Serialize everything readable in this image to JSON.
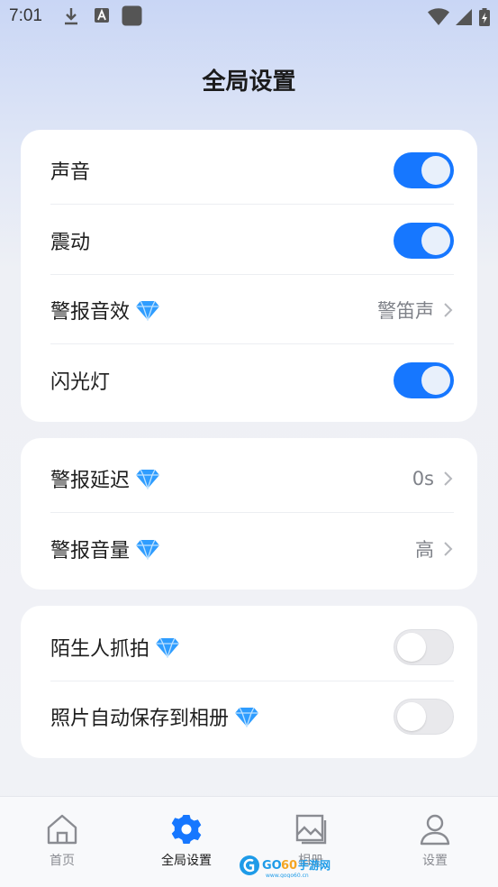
{
  "status_bar": {
    "time": "7:01"
  },
  "title": "全局设置",
  "colors": {
    "accent": "#1677ff",
    "gem": "#2f9dff"
  },
  "groups": [
    {
      "rows": [
        {
          "label": "声音",
          "premium": false,
          "control": "toggle",
          "on": true
        },
        {
          "label": "震动",
          "premium": false,
          "control": "toggle",
          "on": true
        },
        {
          "label": "警报音效",
          "premium": true,
          "control": "value",
          "value": "警笛声"
        },
        {
          "label": "闪光灯",
          "premium": false,
          "control": "toggle",
          "on": true
        }
      ]
    },
    {
      "rows": [
        {
          "label": "警报延迟",
          "premium": true,
          "control": "value",
          "value": "0s"
        },
        {
          "label": "警报音量",
          "premium": true,
          "control": "value",
          "value": "高"
        }
      ]
    },
    {
      "rows": [
        {
          "label": "陌生人抓拍",
          "premium": true,
          "control": "toggle",
          "on": false
        },
        {
          "label": "照片自动保存到相册",
          "premium": true,
          "control": "toggle",
          "on": false
        }
      ]
    }
  ],
  "nav": {
    "home": "首页",
    "global_settings": "全局设置",
    "album": "相册",
    "settings": "设置"
  },
  "watermark": {
    "text": "GOGO手游网",
    "url_text": "www.gogo60.cn"
  }
}
